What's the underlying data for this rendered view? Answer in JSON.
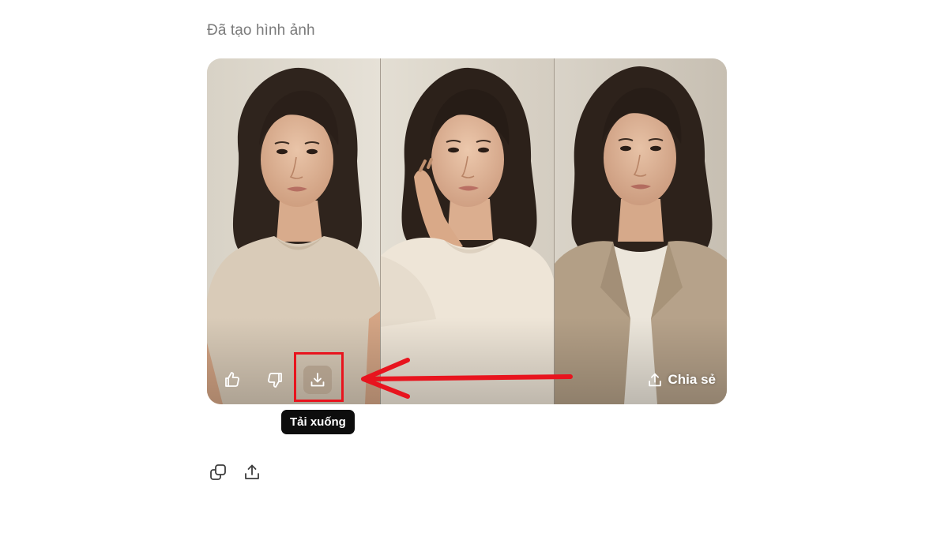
{
  "message": {
    "status_label": "Đã tạo hình ảnh"
  },
  "image_card": {
    "panels": [
      {
        "id": "panel-1",
        "description_icon": "portrait-photo"
      },
      {
        "id": "panel-2",
        "description_icon": "portrait-photo"
      },
      {
        "id": "panel-3",
        "description_icon": "portrait-photo"
      }
    ],
    "actions": {
      "like_icon": "thumbs-up-icon",
      "dislike_icon": "thumbs-down-icon",
      "download_icon": "download-icon",
      "share_label": "Chia sẻ",
      "share_icon": "share-icon"
    },
    "tooltip": "Tải xuống"
  },
  "annotation": {
    "highlight_color": "#e8141e",
    "arrow_color": "#e8141e"
  },
  "action_bar": {
    "copy_icon": "copy-icon",
    "export_icon": "share-icon"
  },
  "colors": {
    "tooltip_bg": "#0d0d0d",
    "status_text": "#7b7b7b",
    "icon_dark": "#3d3d3d"
  }
}
